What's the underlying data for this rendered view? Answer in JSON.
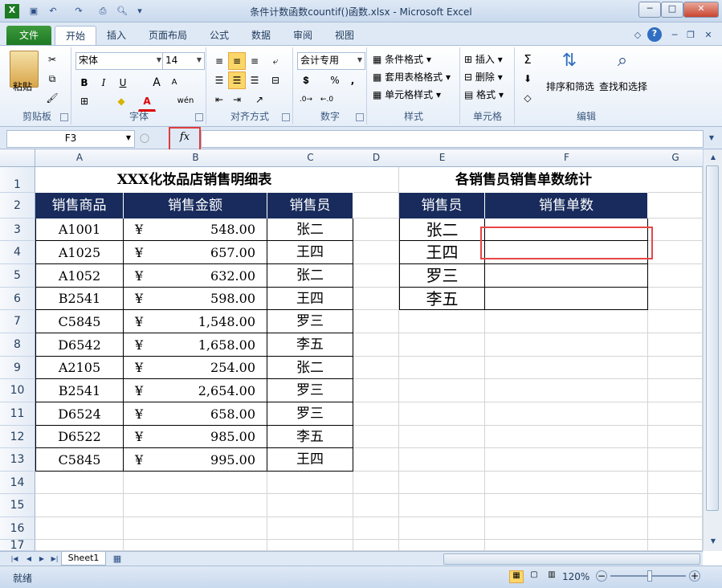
{
  "window": {
    "title": "条件计数函数countif()函数.xlsx - Microsoft Excel",
    "minimize": "─",
    "restore": "□",
    "close": "✕"
  },
  "tabs": [
    "文件",
    "开始",
    "插入",
    "页面布局",
    "公式",
    "数据",
    "审阅",
    "视图"
  ],
  "ribbon": {
    "clipboard": {
      "label": "剪贴板",
      "paste": "粘贴"
    },
    "font": {
      "label": "字体",
      "name": "宋体",
      "size": "14",
      "bold": "B",
      "italic": "I",
      "underline": "U",
      "grow": "A",
      "shrink": "A",
      "wen": "wén"
    },
    "alignment": {
      "label": "对齐方式"
    },
    "number": {
      "label": "数字",
      "format": "会计专用",
      "percent": "%",
      "comma": ","
    },
    "styles": {
      "label": "样式",
      "cond": "条件格式",
      "table": "套用表格格式",
      "cell": "单元格样式"
    },
    "cells": {
      "label": "单元格",
      "insert": "插入",
      "delete": "删除",
      "format": "格式"
    },
    "editing": {
      "label": "编辑",
      "sort": "排序和筛选",
      "find": "查找和选择",
      "sigma": "Σ"
    }
  },
  "formula_bar": {
    "name_box": "F3",
    "fx": "fx",
    "value": ""
  },
  "columns": [
    "A",
    "B",
    "C",
    "D",
    "E",
    "F",
    "G"
  ],
  "rows": [
    "1",
    "2",
    "3",
    "4",
    "5",
    "6",
    "7",
    "8",
    "9",
    "10",
    "11",
    "12",
    "13",
    "14",
    "15",
    "16",
    "17"
  ],
  "sheet": {
    "left_title": "XXX化妆品店销售明细表",
    "right_title": "各销售员销售单数统计",
    "left_headers": [
      "销售商品",
      "销售金额",
      "销售员"
    ],
    "right_headers": [
      "销售员",
      "销售单数"
    ],
    "currency": "¥",
    "left_rows": [
      {
        "item": "A1001",
        "amount": "548.00",
        "seller": "张二"
      },
      {
        "item": "A1025",
        "amount": "657.00",
        "seller": "王四"
      },
      {
        "item": "A1052",
        "amount": "632.00",
        "seller": "张二"
      },
      {
        "item": "B2541",
        "amount": "598.00",
        "seller": "王四"
      },
      {
        "item": "C5845",
        "amount": "1,548.00",
        "seller": "罗三"
      },
      {
        "item": "D6542",
        "amount": "1,658.00",
        "seller": "李五"
      },
      {
        "item": "A2105",
        "amount": "254.00",
        "seller": "张二"
      },
      {
        "item": "B2541",
        "amount": "2,654.00",
        "seller": "罗三"
      },
      {
        "item": "D6524",
        "amount": "658.00",
        "seller": "罗三"
      },
      {
        "item": "D6522",
        "amount": "985.00",
        "seller": "李五"
      },
      {
        "item": "C5845",
        "amount": "995.00",
        "seller": "王四"
      }
    ],
    "right_rows": [
      {
        "seller": "张二",
        "count": ""
      },
      {
        "seller": "王四",
        "count": ""
      },
      {
        "seller": "罗三",
        "count": ""
      },
      {
        "seller": "李五",
        "count": ""
      }
    ]
  },
  "sheet_tab": "Sheet1",
  "status": {
    "ready": "就绪",
    "zoom": "120%"
  },
  "colors": {
    "header_bg": "#182b5c",
    "highlight": "#e84646",
    "file_tab": "#1d7a24"
  }
}
